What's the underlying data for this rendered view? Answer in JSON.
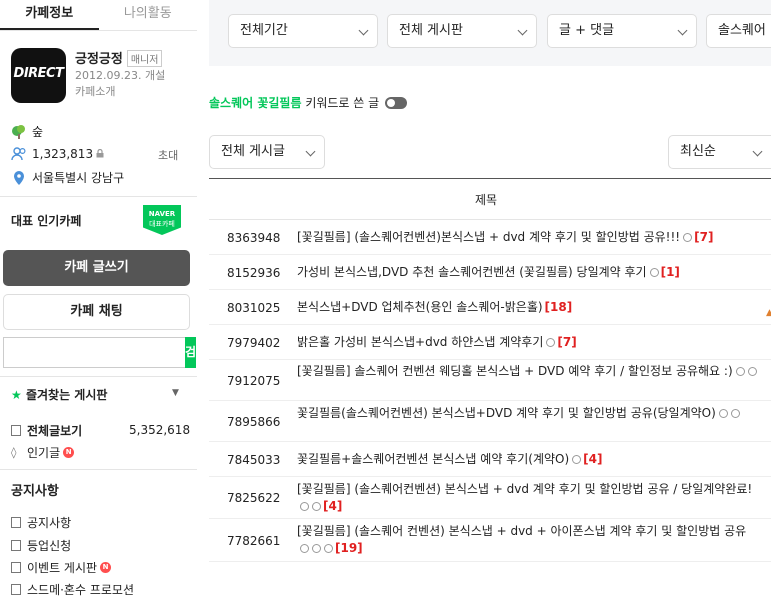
{
  "sidebar": {
    "tabs": [
      "카페정보",
      "나의활동"
    ],
    "cafe": {
      "logo_text": "DIRECT",
      "name": "긍정긍정",
      "role": "매니저",
      "date": "2012.09.23. 개설",
      "intro": "카페소개"
    },
    "level": "숲",
    "members": "1,323,813",
    "invite": "초대",
    "location": "서울특별시 강남구",
    "representative_label": "대표 인기카페",
    "naver_badge_line1": "NAVER",
    "naver_badge_line2": "대표카페",
    "write_button": "카페 글쓰기",
    "chat_button": "카페 채팅",
    "search_button": "검색",
    "favorites_label": "즐겨찾는 게시판",
    "menu": [
      {
        "label": "전체글보기",
        "count": "5,352,618"
      },
      {
        "label": "인기글",
        "badge": "N"
      }
    ],
    "notice_title": "공지사항",
    "notice_items": [
      {
        "label": "공지사항"
      },
      {
        "label": "등업신청"
      },
      {
        "label": "이벤트 게시판",
        "badge": "N"
      },
      {
        "label": "스드메·혼수 프로모션"
      }
    ]
  },
  "filters": {
    "period": "전체기간",
    "board": "전체 게시판",
    "type": "글 + 댓글",
    "keyword": "솔스퀘어"
  },
  "keyword_row": {
    "keyword": "솔스퀘어 꽃길필름",
    "suffix": " 키워드로 쓴 글"
  },
  "list_controls": {
    "board_select": "전체 게시글",
    "sort_select": "최신순"
  },
  "table": {
    "title_header": "제목",
    "rows": [
      {
        "num": "8363948",
        "title": "[꽃길필름] (솔스퀘어컨벤션)본식스냅 + dvd 계약 후기 및 할인방법 공유!!!",
        "comments": "[7]"
      },
      {
        "num": "8152936",
        "title": "가성비 본식스냅,DVD 추천 솔스퀘어컨벤션 (꽃길필름) 당일계약 후기",
        "comments": "[1]"
      },
      {
        "num": "8031025",
        "title": "본식스냅+DVD 업체추천(용인 솔스퀘어-밝은홀)",
        "comments": "[18]"
      },
      {
        "num": "7979402",
        "title": "밝은홀 가성비 본식스냅+dvd 하얀스냅 계약후기",
        "comments": "[7]"
      },
      {
        "num": "7912075",
        "title": "[꽃길필름] 솔스퀘어 컨벤션 웨딩홀 본식스냅 + DVD 예약 후기 / 할인정보 공유해요 :)",
        "comments": ""
      },
      {
        "num": "7895866",
        "title": "꽃길필름(솔스퀘어컨벤션) 본식스냅+DVD 계약 후기 및 할인방법 공유(당일계약O)",
        "comments": ""
      },
      {
        "num": "7845033",
        "title": "꽃길필름+솔스퀘어컨벤션 본식스냅 예약 후기(계약O)",
        "comments": "[4]"
      },
      {
        "num": "7825622",
        "title": "[꽃길필름] (솔스퀘어컨벤션) 본식스냅 + dvd 계약 후기 및 할인방법 공유 / 당일계약완료!",
        "comments": "[4]"
      },
      {
        "num": "7782661",
        "title": "[꽃길필름] (솔스퀘어 컨벤션) 본식스냅 + dvd + 아이폰스냅 계약 후기 및 할인방법 공유",
        "comments": "[19]"
      }
    ]
  }
}
